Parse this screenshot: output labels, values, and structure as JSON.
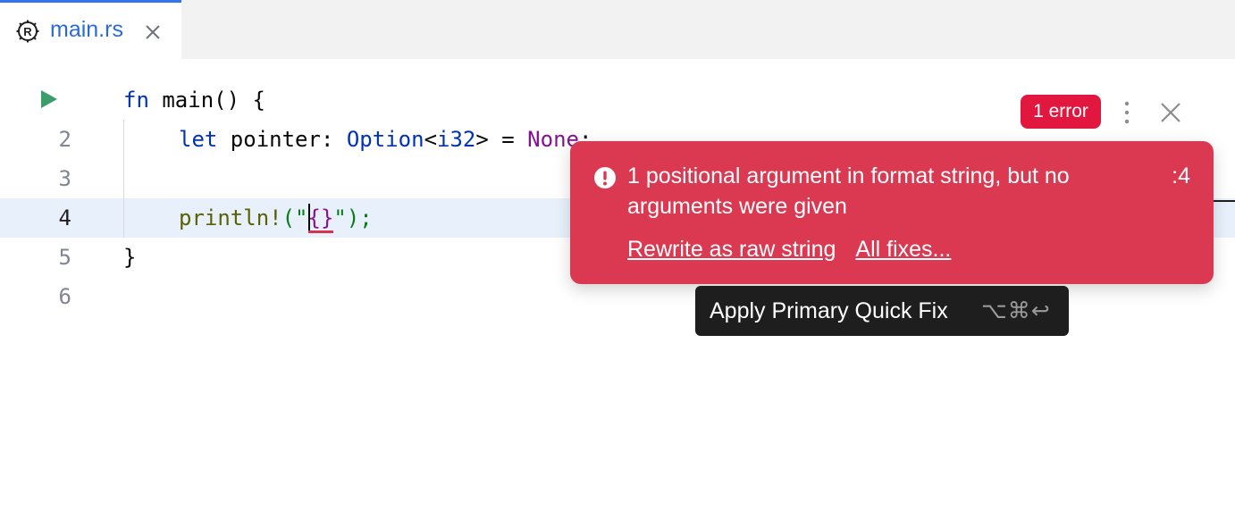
{
  "tab": {
    "icon": "rust-file-icon",
    "label": "main.rs",
    "close_icon": "close-icon"
  },
  "gutter": {
    "run_icon": "run-icon",
    "line_numbers": [
      "2",
      "3",
      "4",
      "5",
      "6"
    ],
    "current_line": "4"
  },
  "code": {
    "line1": {
      "kw": "fn",
      "rest": " main() {"
    },
    "line2": {
      "kw": "let",
      "mid": " pointer: ",
      "type": "Option",
      "lt": "<",
      "type2": "i32",
      "gt": "> = ",
      "none": "None",
      "semi": ";"
    },
    "line4": {
      "macro": "println!",
      "open": "(\"",
      "fmt": "{}",
      "close": "\");"
    },
    "line5": "}"
  },
  "inspections": {
    "badge": "1 error",
    "more_icon": "more-vertical-icon",
    "close_icon": "close-icon"
  },
  "popup": {
    "icon": "error-exclamation-icon",
    "message": "1 positional argument in format string, but no arguments were given",
    "line_ref": ":4",
    "actions": [
      "Rewrite as raw string",
      "All fixes..."
    ]
  },
  "tooltip": {
    "label": "Apply Primary Quick Fix",
    "shortcut": "⌥⌘↩"
  },
  "colors": {
    "accent": "#3574f0",
    "error": "#da3951",
    "badge": "#e2173f"
  }
}
